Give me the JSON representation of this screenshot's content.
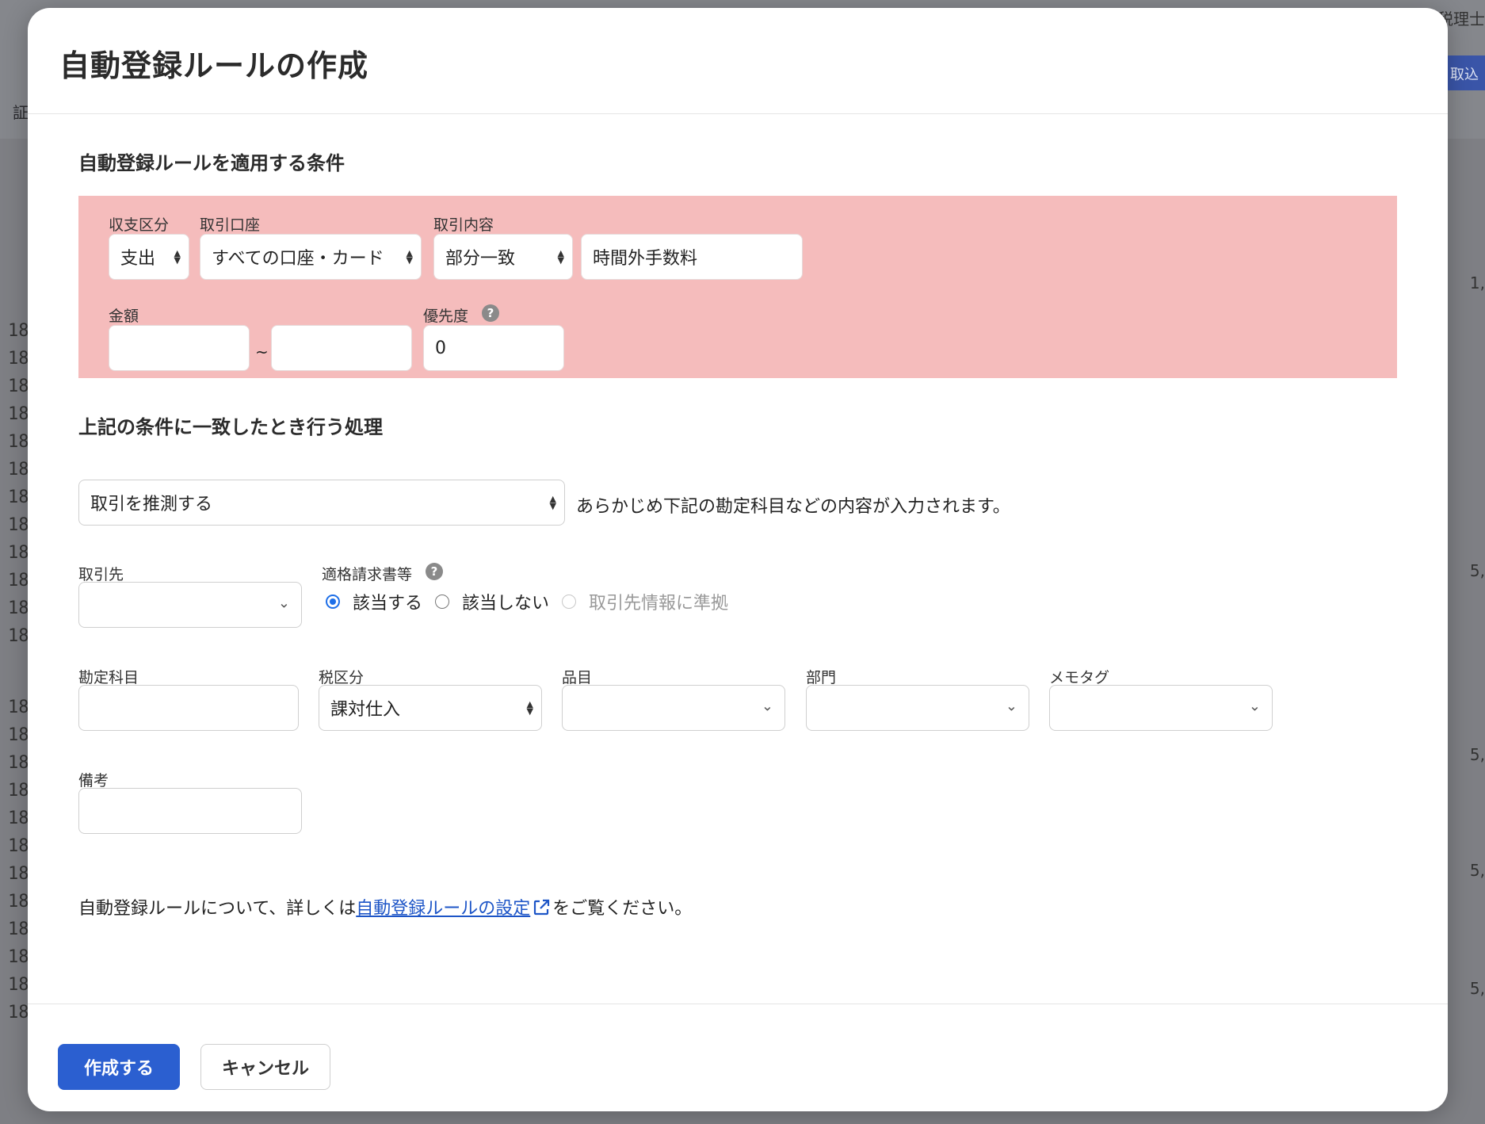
{
  "background": {
    "top_right_text": "税理士",
    "import_button": "取込",
    "left_label": "証",
    "right_values": [
      "1,",
      "5,",
      "5,",
      "5,",
      "5,"
    ],
    "row_number": "18"
  },
  "modal": {
    "title": "自動登録ルールの作成",
    "conditions": {
      "section_title": "自動登録ルールを適用する条件",
      "type_label": "収支区分",
      "type_value": "支出",
      "account_label": "取引口座",
      "account_value": "すべての口座・カード",
      "content_label": "取引内容",
      "match_value": "部分一致",
      "keyword_value": "時間外手数料",
      "amount_label": "金額",
      "amount_min": "",
      "amount_separator": "~",
      "amount_max": "",
      "priority_label": "優先度",
      "priority_value": "0"
    },
    "action": {
      "section_title": "上記の条件に一致したとき行う処理",
      "action_value": "取引を推測する",
      "action_description": "あらかじめ下記の勘定科目などの内容が入力されます。",
      "partner_label": "取引先",
      "partner_value": "",
      "invoice_label": "適格請求書等",
      "invoice_options": [
        "該当する",
        "該当しない",
        "取引先情報に準拠"
      ],
      "invoice_selected": "該当する",
      "account_item_label": "勘定科目",
      "account_item_value": "",
      "tax_label": "税区分",
      "tax_value": "課対仕入",
      "item_label": "品目",
      "item_value": "",
      "section_label": "部門",
      "section_value": "",
      "memo_tag_label": "メモタグ",
      "memo_tag_value": "",
      "remarks_label": "備考",
      "remarks_value": ""
    },
    "help_note": {
      "prefix": "自動登録ルールについて、詳しくは",
      "link_text": "自動登録ルールの設定",
      "suffix": "をご覧ください。"
    },
    "footer": {
      "create_label": "作成する",
      "cancel_label": "キャンセル"
    }
  },
  "colors": {
    "condition_bg": "#f5bcbc",
    "primary": "#2b5fd0",
    "link": "#1d55c7",
    "radio_active": "#1e6fe8"
  }
}
